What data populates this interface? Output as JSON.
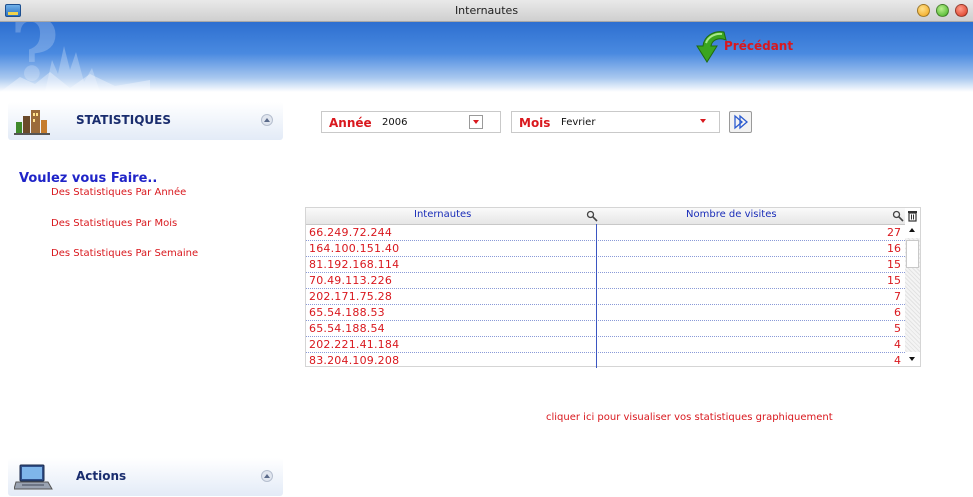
{
  "window": {
    "title": "Internautes"
  },
  "header": {
    "previous_label": "Précédant"
  },
  "sidebar": {
    "stats_panel_title": "STATISTIQUES",
    "question": "Voulez vous Faire..",
    "links": [
      "Des Statistiques Par Année",
      "Des Statistiques Par Mois",
      "Des Statistiques Par Semaine"
    ],
    "actions_panel_title": "Actions"
  },
  "filters": {
    "year_label": "Année",
    "year_value": "2006",
    "month_label": "Mois",
    "month_value": "Fevrier"
  },
  "table": {
    "columns": [
      "Internautes",
      "Nombre de visites"
    ],
    "rows": [
      {
        "ip": "66.249.72.244",
        "visits": "27"
      },
      {
        "ip": "164.100.151.40",
        "visits": "16"
      },
      {
        "ip": "81.192.168.114",
        "visits": "15"
      },
      {
        "ip": "70.49.113.226",
        "visits": "15"
      },
      {
        "ip": "202.171.75.28",
        "visits": "7"
      },
      {
        "ip": "65.54.188.53",
        "visits": "6"
      },
      {
        "ip": "65.54.188.54",
        "visits": "5"
      },
      {
        "ip": "202.221.41.184",
        "visits": "4"
      },
      {
        "ip": "83.204.109.208",
        "visits": "4"
      }
    ]
  },
  "graph_link": "cliquer ici pour visualiser vos statistiques graphiquement",
  "colors": {
    "accent_red": "#d9181e",
    "link_blue": "#1f24c8",
    "banner_blue": "#2d6fd0"
  },
  "icons": {
    "app": "app-window-icon",
    "previous": "green-back-arrow-icon",
    "stats": "statistics-buildings-icon",
    "actions": "laptop-icon",
    "go": "go-arrow-icon",
    "search": "magnifier-icon",
    "trash": "trash-icon"
  }
}
